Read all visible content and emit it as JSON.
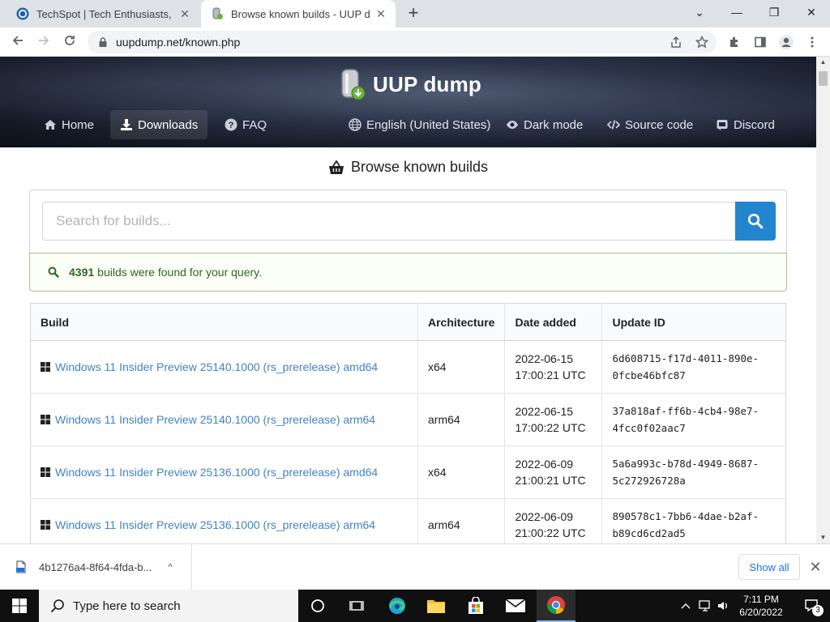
{
  "browser": {
    "tabs": [
      {
        "title": "TechSpot | Tech Enthusiasts, Pow",
        "active": false,
        "favicon": "techspot-icon"
      },
      {
        "title": "Browse known builds - UUP dum",
        "active": true,
        "favicon": "uup-dump-icon"
      }
    ],
    "close_glyph": "✕",
    "new_tab_glyph": "+",
    "window_controls": {
      "minimize": "—",
      "restore": "❐",
      "close": "✕",
      "chevron": "⌄"
    },
    "address": "uupdump.net/known.php",
    "icons": [
      "back-icon",
      "forward-icon",
      "reload-icon",
      "lock-icon",
      "share-icon",
      "star-icon",
      "extensions-icon",
      "sidepanel-icon",
      "profile-icon",
      "menu-icon"
    ]
  },
  "site": {
    "brand": "UUP dump",
    "nav": [
      {
        "label": "Home",
        "icon": "home-icon",
        "active": false
      },
      {
        "label": "Downloads",
        "icon": "download-icon",
        "active": true
      },
      {
        "label": "FAQ",
        "icon": "question-icon",
        "active": false
      },
      {
        "label": "English (United States)",
        "icon": "globe-icon",
        "active": false
      },
      {
        "label": "Dark mode",
        "icon": "eye-icon",
        "active": false
      },
      {
        "label": "Source code",
        "icon": "code-icon",
        "active": false
      },
      {
        "label": "Discord",
        "icon": "discord-icon",
        "active": false
      }
    ],
    "accent_color": "#2185d0",
    "link_color": "#4183c4"
  },
  "page": {
    "title": "Browse known builds",
    "search": {
      "placeholder": "Search for builds...",
      "value": ""
    },
    "result": {
      "count": "4391",
      "text": "builds were found for your query."
    },
    "table": {
      "headers": [
        "Build",
        "Architecture",
        "Date added",
        "Update ID"
      ],
      "rows": [
        {
          "build": "Windows 11 Insider Preview 25140.1000 (rs_prerelease) amd64",
          "arch": "x64",
          "date": "2022-06-15",
          "time": "17:00:21 UTC",
          "uid1": "6d608715-f17d-4011-890e-",
          "uid2": "0fcbe46bfc87"
        },
        {
          "build": "Windows 11 Insider Preview 25140.1000 (rs_prerelease) arm64",
          "arch": "arm64",
          "date": "2022-06-15",
          "time": "17:00:22 UTC",
          "uid1": "37a818af-ff6b-4cb4-98e7-",
          "uid2": "4fcc0f02aac7"
        },
        {
          "build": "Windows 11 Insider Preview 25136.1000 (rs_prerelease) amd64",
          "arch": "x64",
          "date": "2022-06-09",
          "time": "21:00:21 UTC",
          "uid1": "5a6a993c-b78d-4949-8687-",
          "uid2": "5c272926728a"
        },
        {
          "build": "Windows 11 Insider Preview 25136.1000 (rs_prerelease) arm64",
          "arch": "arm64",
          "date": "2022-06-09",
          "time": "21:00:22 UTC",
          "uid1": "890578c1-7bb6-4dae-b2af-",
          "uid2": "b89cd6cd2ad5"
        }
      ]
    }
  },
  "downloads": {
    "item": "4b1276a4-8f64-4fda-b...",
    "item_menu_glyph": "^",
    "show_all": "Show all",
    "close_glyph": "✕"
  },
  "taskbar": {
    "search_placeholder": "Type here to search",
    "time": "7:11 PM",
    "date": "6/20/2022",
    "notification_count": "3",
    "apps": [
      "task-view-icon",
      "edge-icon",
      "file-explorer-icon",
      "store-icon",
      "mail-icon",
      "chrome-icon"
    ]
  }
}
